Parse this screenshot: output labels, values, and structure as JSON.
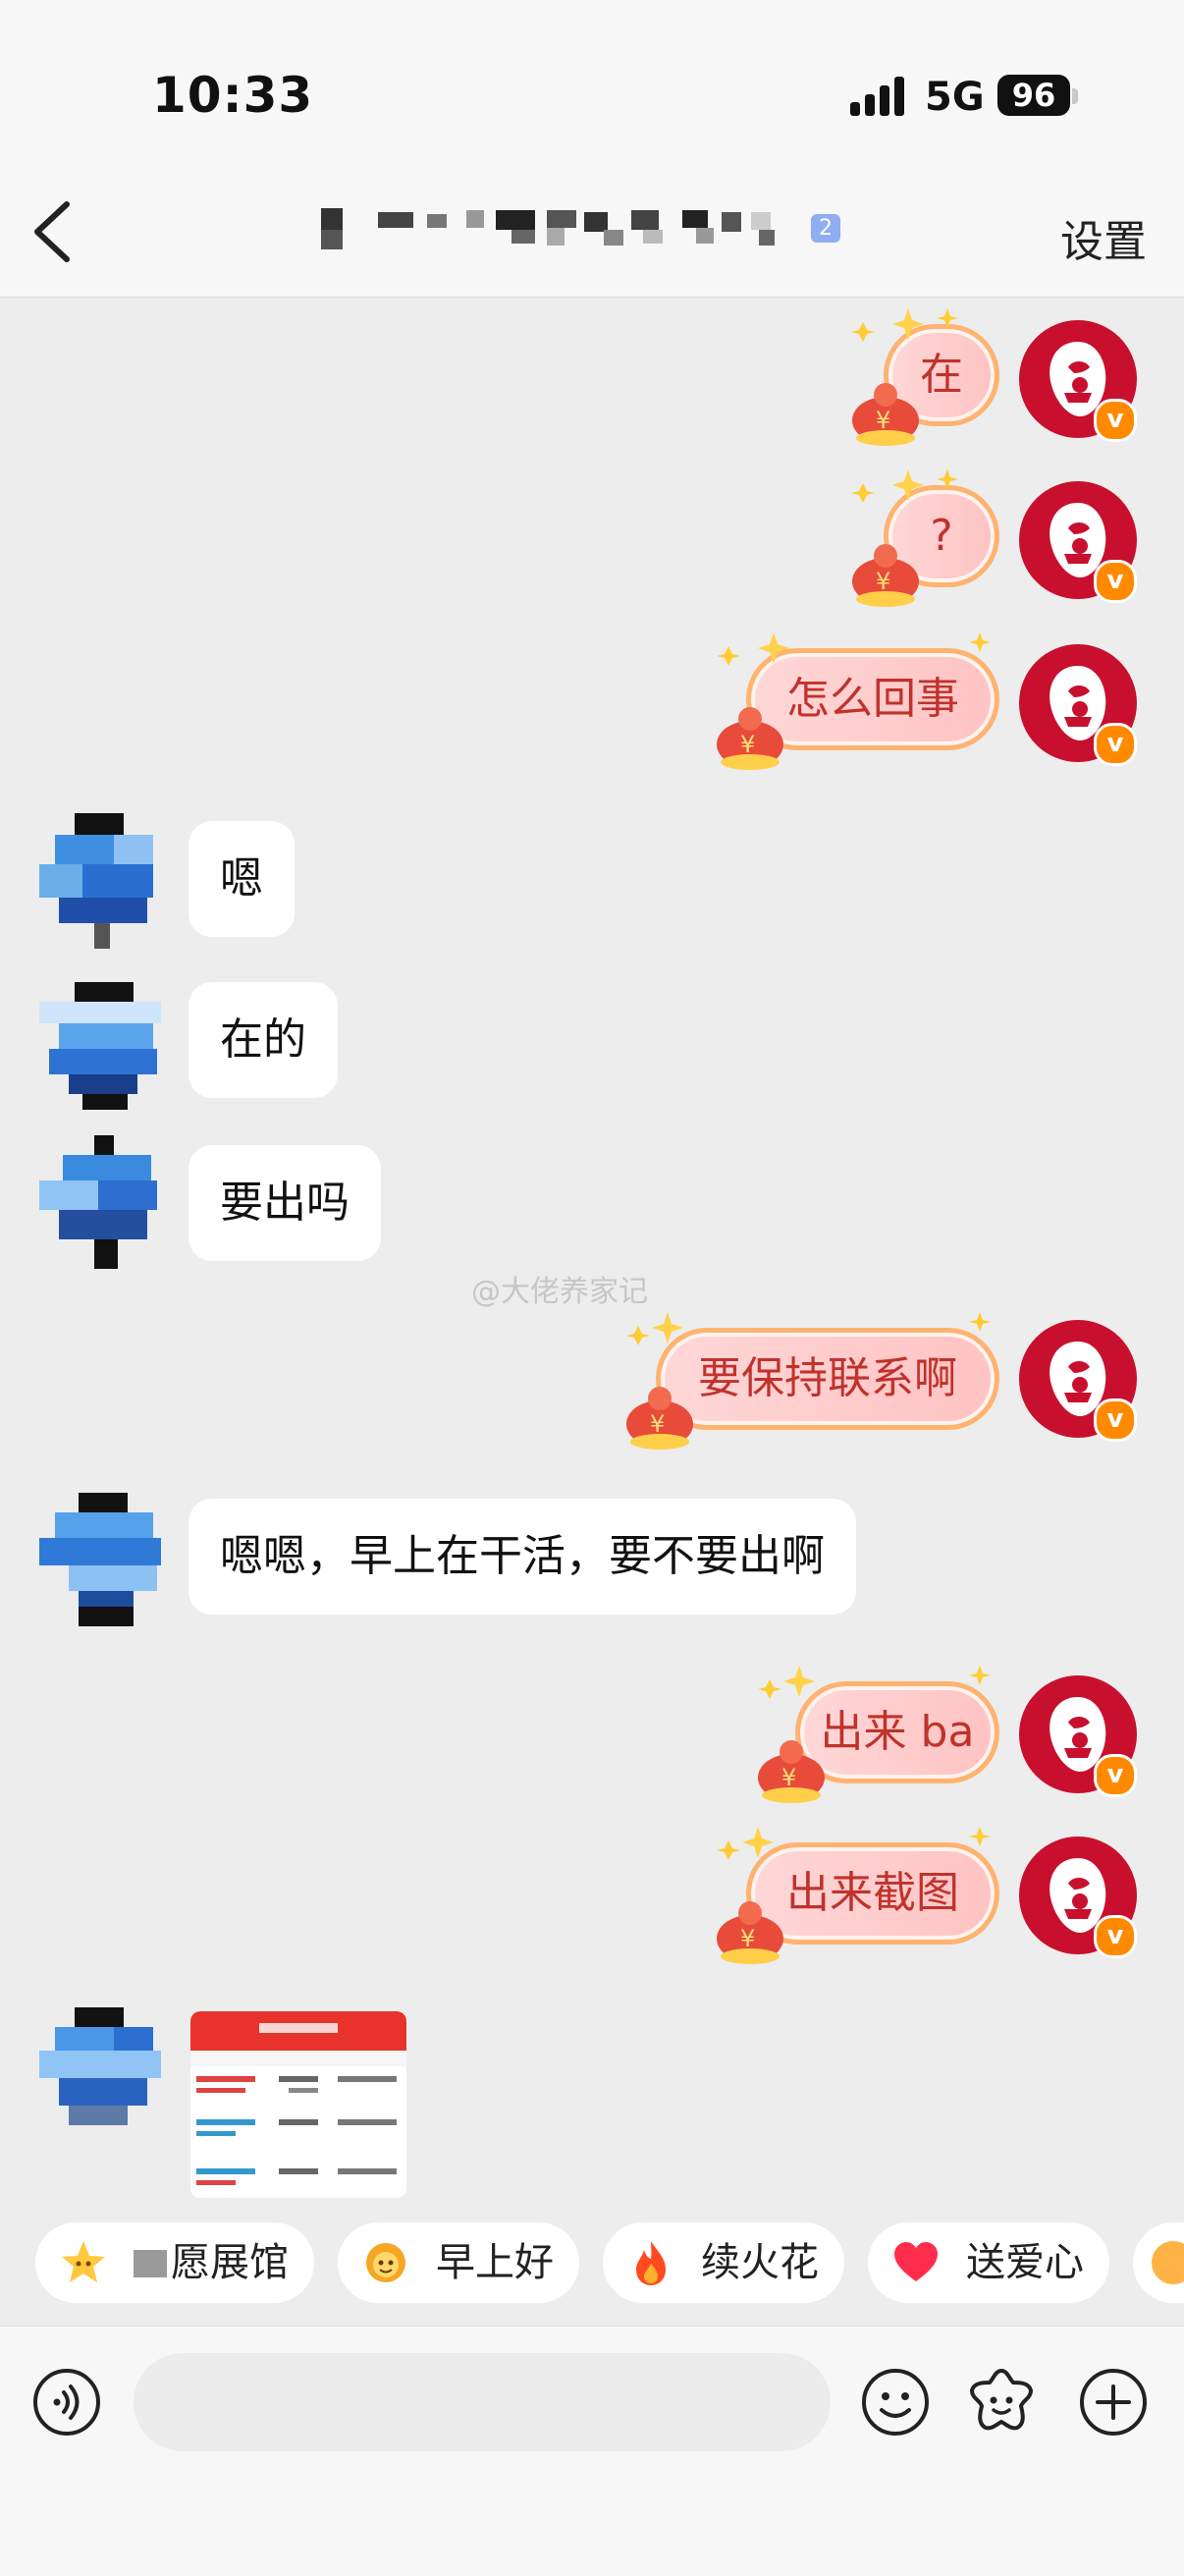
{
  "status": {
    "time": "10:33",
    "network": "5G",
    "battery": "96"
  },
  "header": {
    "title_suffix": "2",
    "settings_label": "设置"
  },
  "messages": {
    "m1": "在",
    "m2": "?",
    "m3": "怎么回事",
    "m4": "嗯",
    "m5": "在的",
    "m6": "要出吗",
    "m7": "要保持联系啊",
    "m8": "嗯嗯，早上在干活，要不要出啊",
    "m9": "出来 ba",
    "m10": "出来截图"
  },
  "watermark": "@大佬养家记",
  "quick_replies": [
    {
      "label": "愿展馆",
      "icon": "star-face-icon"
    },
    {
      "label": "早上好",
      "icon": "sun-face-icon"
    },
    {
      "label": "续火花",
      "icon": "fire-icon"
    },
    {
      "label": "送爱心",
      "icon": "heart-icon"
    }
  ],
  "colors": {
    "accent": "#c0322c",
    "avatar_bg": "#c8102e",
    "badge": "#ff8a00"
  }
}
